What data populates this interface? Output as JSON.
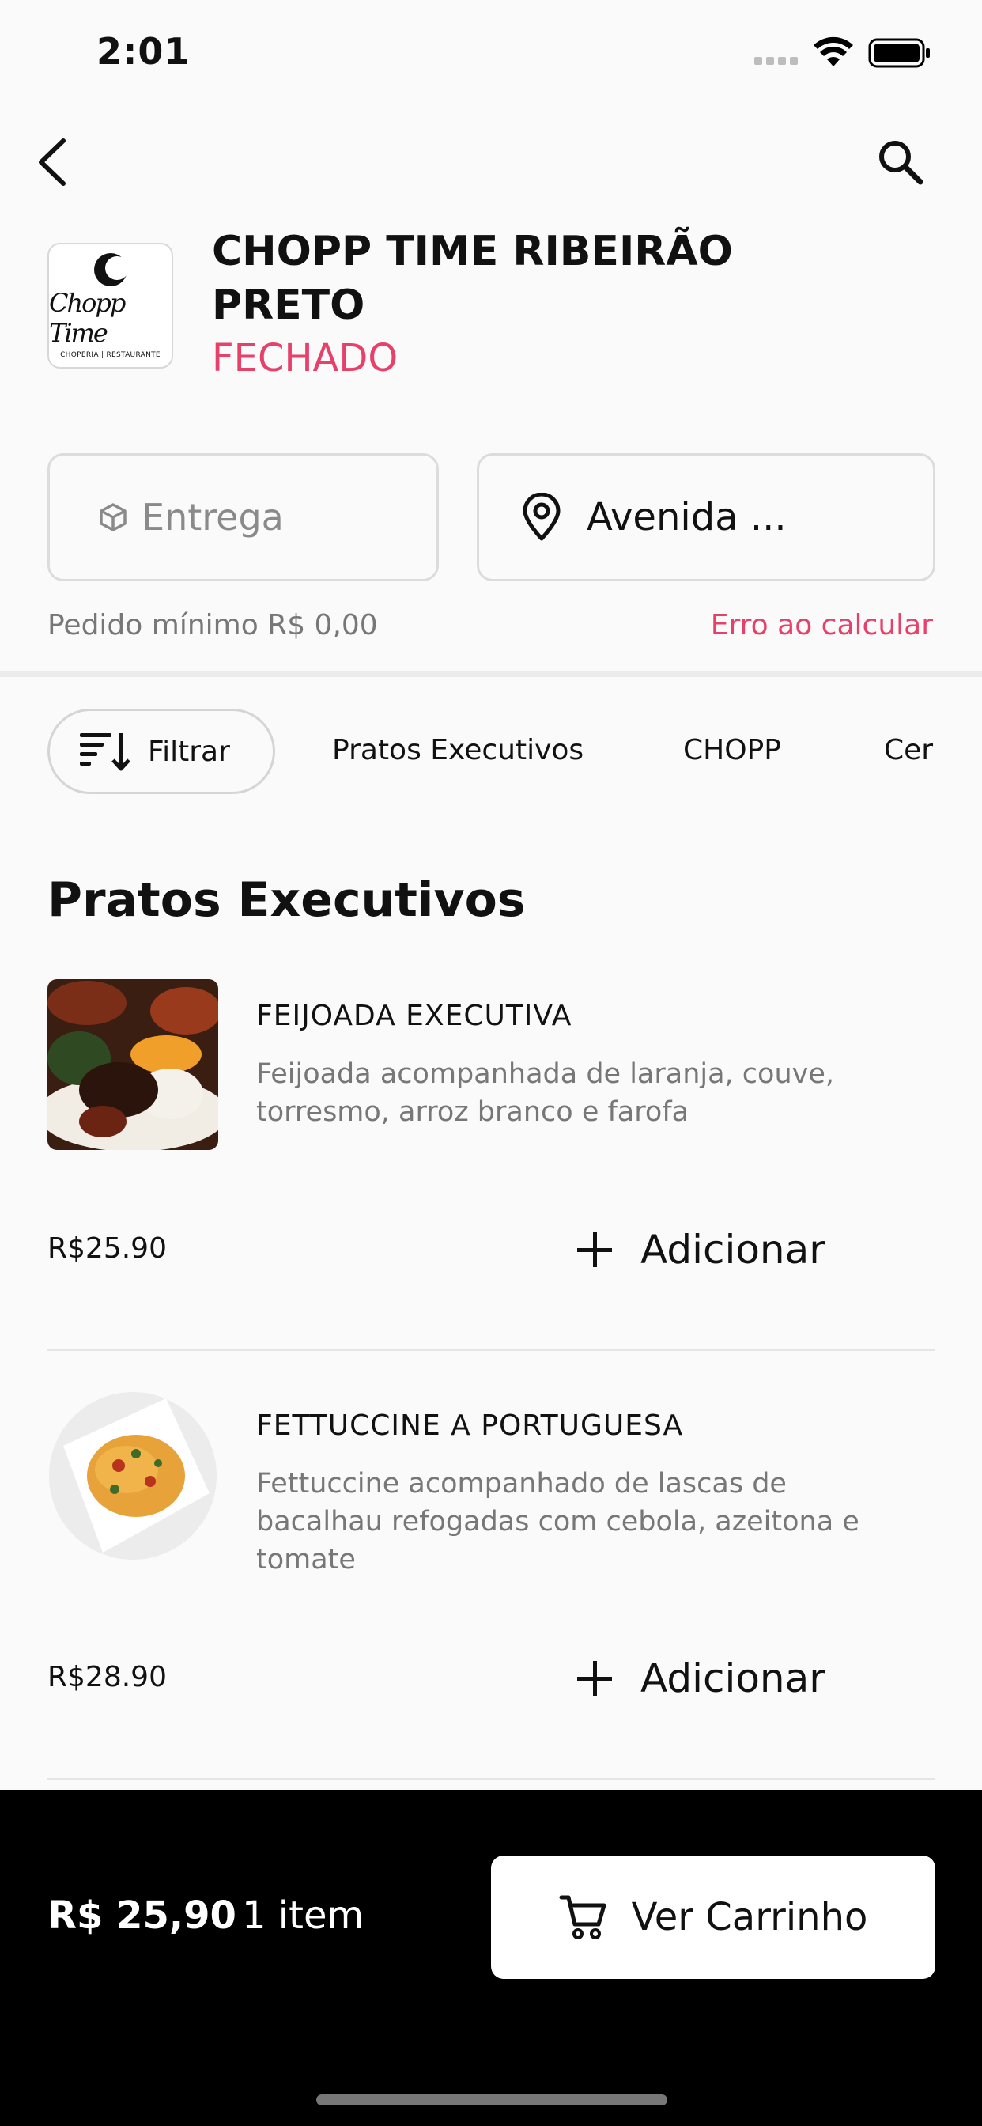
{
  "status_bar": {
    "time": "2:01"
  },
  "restaurant": {
    "name": "CHOPP TIME RIBEIRÃO PRETO",
    "status": "FECHADO",
    "logo": {
      "brand": "Chopp Time",
      "subtitle": "CHOPERIA | RESTAURANTE"
    }
  },
  "delivery": {
    "mode_label": "Entrega",
    "address_label": "Avenida ...",
    "min_order": "Pedido mínimo R$ 0,00",
    "error": "Erro ao calcular"
  },
  "filters": {
    "filter_label": "Filtrar",
    "categories": [
      "Pratos Executivos",
      "CHOPP",
      "Cer"
    ]
  },
  "section": {
    "title": "Pratos Executivos"
  },
  "items": [
    {
      "name": "FEIJOADA EXECUTIVA",
      "description": "Feijoada acompanhada de laranja, couve, torresmo, arroz branco e farofa",
      "price": "R$25.90",
      "add_label": "Adicionar"
    },
    {
      "name": "FETTUCCINE  A PORTUGUESA",
      "description": "Fettuccine acompanhado de lascas de bacalhau refogadas com cebola, azeitona e tomate",
      "price": "R$28.90",
      "add_label": "Adicionar"
    }
  ],
  "cart": {
    "total": "R$ 25,90",
    "count": "1 item",
    "button_label": "Ver Carrinho"
  },
  "colors": {
    "accent": "#e7406b",
    "cart_bar": "#000000"
  }
}
